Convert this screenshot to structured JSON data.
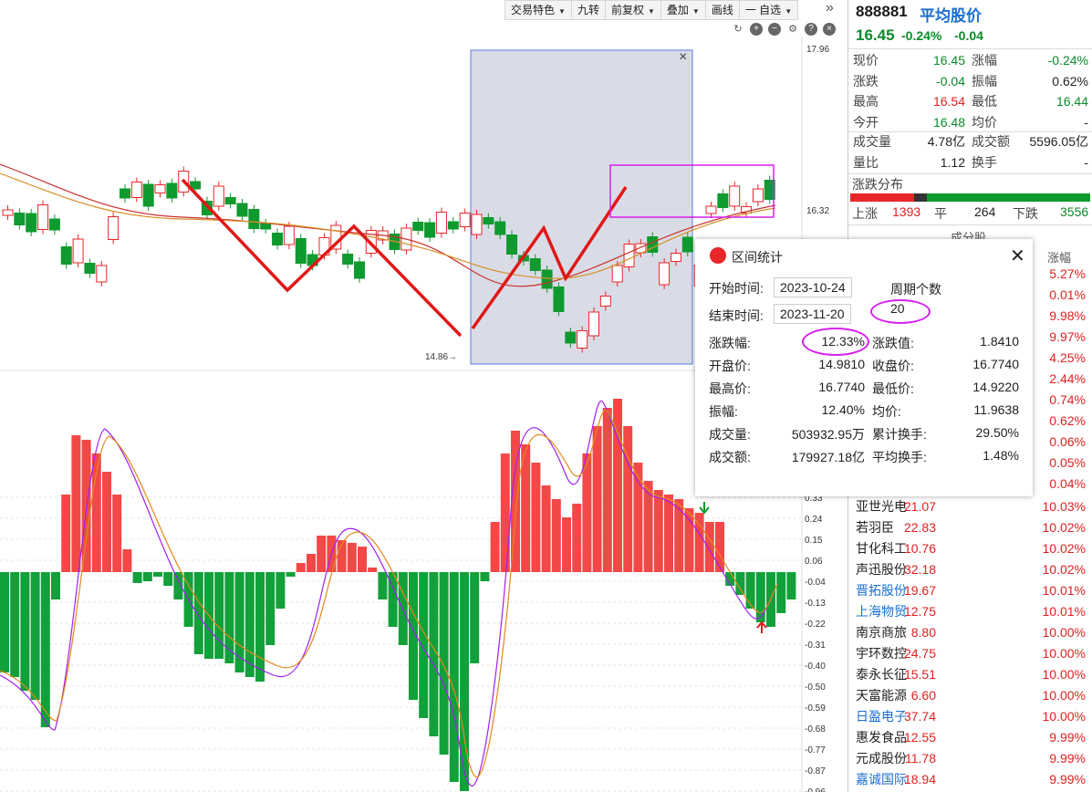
{
  "toolbar": {
    "buttons": [
      {
        "label": "交易特色",
        "caret": "▼"
      },
      {
        "label": "九转",
        "caret": ""
      },
      {
        "label": "前复权",
        "caret": "▼"
      },
      {
        "label": "叠加",
        "caret": "▼"
      },
      {
        "label": "画线",
        "caret": ""
      },
      {
        "label": "一 自选",
        "caret": "▼"
      }
    ],
    "more_icon": "»"
  },
  "chart_icons": [
    "refresh-icon",
    "zoom-in-icon",
    "zoom-out-icon",
    "settings-icon",
    "help-icon",
    "close-icon"
  ],
  "main_chart": {
    "y_labels_top": [
      "17.96",
      "16.32"
    ],
    "low_marker": "14.86",
    "macd_axis": [
      "0.33",
      "0.24",
      "0.15",
      "0.06",
      "-0.04",
      "-0.13",
      "-0.22",
      "-0.31",
      "-0.40",
      "-0.50",
      "-0.59",
      "-0.68",
      "-0.77",
      "-0.87",
      "-0.96"
    ]
  },
  "quote": {
    "code": "888881",
    "name": "平均股价",
    "price": "16.45",
    "pct": "-0.24%",
    "change": "-0.04",
    "rows": [
      {
        "l1": "现价",
        "v1": "16.45",
        "c1": "green",
        "l2": "涨幅",
        "v2": "-0.24%",
        "c2": "green"
      },
      {
        "l1": "涨跌",
        "v1": "-0.04",
        "c1": "green",
        "l2": "振幅",
        "v2": "0.62%",
        "c2": "dark"
      },
      {
        "l1": "最高",
        "v1": "16.54",
        "c1": "red",
        "l2": "最低",
        "v2": "16.44",
        "c2": "green"
      },
      {
        "l1": "今开",
        "v1": "16.48",
        "c1": "green",
        "l2": "均价",
        "v2": "-",
        "c2": "dark"
      }
    ],
    "rows2": [
      {
        "l1": "成交量",
        "v1": "4.78亿",
        "c1": "dark",
        "l2": "成交额",
        "v2": "5596.05亿",
        "c2": "dark"
      },
      {
        "l1": "量比",
        "v1": "1.12",
        "c1": "dark",
        "l2": "换手",
        "v2": "-",
        "c2": "dark"
      }
    ],
    "distribution": {
      "title": "涨跌分布",
      "up_label": "上涨",
      "up": "1393",
      "flat_label": "平",
      "flat": "264",
      "down_label": "下跌",
      "down": "3556",
      "up_share": 0.267,
      "flat_share": 0.051,
      "down_share": 0.682
    },
    "component_title": "成分股",
    "component_header_pct": "涨幅",
    "hidden_pcts": [
      "5.27%",
      "0.01%",
      "9.98%",
      "9.97%",
      "4.25%",
      "2.44%",
      "0.74%",
      "0.62%",
      "0.06%",
      "0.05%",
      "0.04%"
    ],
    "components": [
      {
        "name": "亚世光电",
        "price": "21.07",
        "pct": "10.03%",
        "link": false
      },
      {
        "name": "若羽臣",
        "price": "22.83",
        "pct": "10.02%",
        "link": false
      },
      {
        "name": "甘化科工",
        "price": "10.76",
        "pct": "10.02%",
        "link": false
      },
      {
        "name": "声迅股份",
        "price": "32.18",
        "pct": "10.02%",
        "link": false
      },
      {
        "name": "晋拓股份",
        "price": "19.67",
        "pct": "10.01%",
        "link": true
      },
      {
        "name": "上海物贸",
        "price": "12.75",
        "pct": "10.01%",
        "link": true
      },
      {
        "name": "南京商旅",
        "price": "8.80",
        "pct": "10.00%",
        "link": false
      },
      {
        "name": "宇环数控",
        "price": "24.75",
        "pct": "10.00%",
        "link": false
      },
      {
        "name": "泰永长征",
        "price": "15.51",
        "pct": "10.00%",
        "link": false
      },
      {
        "name": "天富能源",
        "price": "6.60",
        "pct": "10.00%",
        "link": false
      },
      {
        "name": "日盈电子",
        "price": "37.74",
        "pct": "10.00%",
        "link": true
      },
      {
        "name": "惠发食品",
        "price": "12.55",
        "pct": "9.99%",
        "link": false
      },
      {
        "name": "元成股份",
        "price": "11.78",
        "pct": "9.99%",
        "link": false
      },
      {
        "name": "嘉诚国际",
        "price": "18.94",
        "pct": "9.99%",
        "link": true
      }
    ]
  },
  "popup": {
    "title": "区间统计",
    "start_label": "开始时间:",
    "start": "2023-10-24",
    "end_label": "结束时间:",
    "end": "2023-11-20",
    "period_label": "周期个数",
    "period": "20",
    "stats": [
      {
        "l1": "涨跌幅:",
        "v1": "12.33%",
        "l2": "涨跌值:",
        "v2": "1.8410"
      },
      {
        "l1": "开盘价:",
        "v1": "14.9810",
        "l2": "收盘价:",
        "v2": "16.7740"
      },
      {
        "l1": "最高价:",
        "v1": "16.7740",
        "l2": "最低价:",
        "v2": "14.9220"
      },
      {
        "l1": "振幅:",
        "v1": "12.40%",
        "l2": "均价:",
        "v2": "11.9638"
      },
      {
        "l1": "成交量:",
        "v1": "503932.95万",
        "l2": "累计换手:",
        "v2": "29.50%"
      },
      {
        "l1": "成交额:",
        "v1": "179927.18亿",
        "l2": "平均换手:",
        "v2": "1.48%"
      }
    ]
  },
  "colors": {
    "up": "#e8262a",
    "down": "#0f9a2f",
    "highlight": "#d2d6e2",
    "magenta": "#d61ff0",
    "ma1": "#cc3030",
    "ma2": "#d8902a"
  }
}
